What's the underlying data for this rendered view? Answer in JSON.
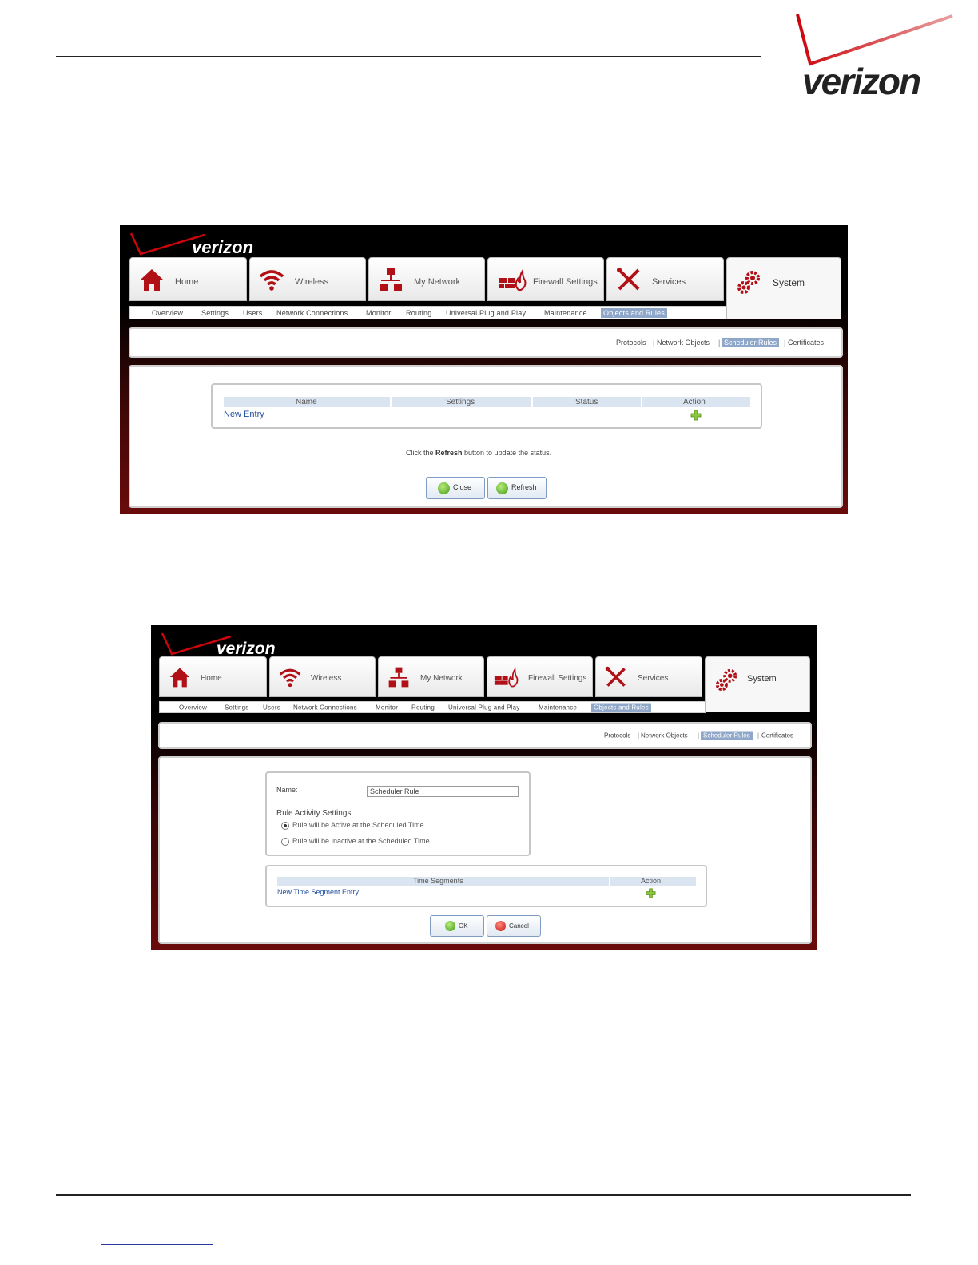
{
  "brand": {
    "logo_text": "verizon",
    "accent": "#cd040b"
  },
  "shot1": {
    "logo_text": "verizon",
    "tabs": [
      {
        "label": "Home",
        "icon": "home-icon"
      },
      {
        "label": "Wireless",
        "icon": "wifi-icon"
      },
      {
        "label": "My Network",
        "icon": "network-icon"
      },
      {
        "label": "Firewall Settings",
        "icon": "firewall-icon"
      },
      {
        "label": "Services",
        "icon": "tools-icon"
      },
      {
        "label": "System",
        "icon": "gears-icon"
      }
    ],
    "subnav": [
      "Overview",
      "Settings",
      "Users",
      "Network Connections",
      "Monitor",
      "Routing",
      "Universal Plug and Play",
      "Maintenance",
      "Objects and Rules"
    ],
    "crumbs": [
      "Protocols",
      "Network Objects",
      "Scheduler Rules",
      "Certificates"
    ],
    "table": {
      "headers": [
        "Name",
        "Settings",
        "Status",
        "Action"
      ],
      "new_entry": "New Entry"
    },
    "note_prefix": "Click the ",
    "note_bold": "Refresh",
    "note_suffix": " button to update the status.",
    "buttons": {
      "close": "Close",
      "refresh": "Refresh"
    }
  },
  "shot2": {
    "logo_text": "verizon",
    "tabs": [
      {
        "label": "Home",
        "icon": "home-icon"
      },
      {
        "label": "Wireless",
        "icon": "wifi-icon"
      },
      {
        "label": "My Network",
        "icon": "network-icon"
      },
      {
        "label": "Firewall Settings",
        "icon": "firewall-icon"
      },
      {
        "label": "Services",
        "icon": "tools-icon"
      },
      {
        "label": "System",
        "icon": "gears-icon"
      }
    ],
    "subnav": [
      "Overview",
      "Settings",
      "Users",
      "Network Connections",
      "Monitor",
      "Routing",
      "Universal Plug and Play",
      "Maintenance",
      "Objects and Rules"
    ],
    "crumbs": [
      "Protocols",
      "Network Objects",
      "Scheduler Rules",
      "Certificates"
    ],
    "form": {
      "name_label": "Name:",
      "name_value": "Scheduler Rule",
      "section": "Rule Activity Settings",
      "radio_active": "Rule will be Active at the Scheduled Time",
      "radio_inactive": "Rule will be Inactive at the Scheduled Time"
    },
    "segments": {
      "headers": [
        "Time Segments",
        "Action"
      ],
      "new_entry": "New Time Segment Entry"
    },
    "buttons": {
      "ok": "OK",
      "cancel": "Cancel"
    }
  }
}
